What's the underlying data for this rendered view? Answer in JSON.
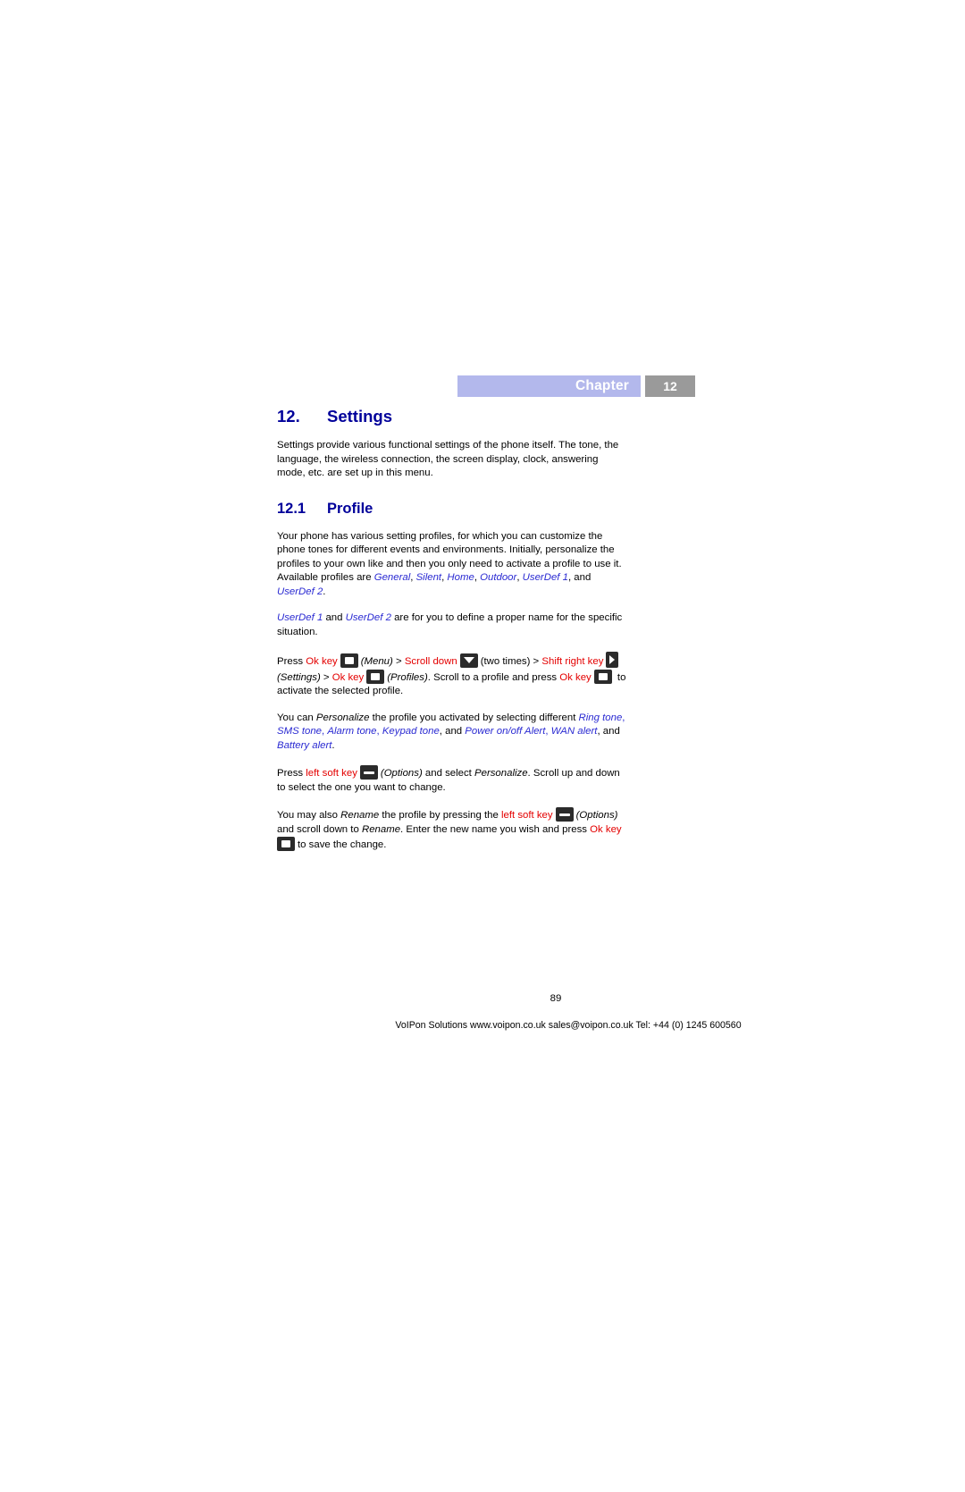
{
  "header": {
    "chapter_label": "Chapter",
    "chapter_number": "12",
    "bar_color": "#b3b8ec",
    "number_box_color": "#9a9a9a"
  },
  "heading": {
    "section_number": "12.",
    "section_title": "Settings",
    "subsection_number": "12.1",
    "subsection_title": "Profile",
    "heading_color": "#00009a"
  },
  "body": {
    "intro": "Settings provide various functional settings of the phone itself. The tone, the language, the wireless connection, the screen display, clock, answering mode, etc. are set up in this menu.",
    "profile_para_1_a": "Your phone has various setting profiles, for which you can customize the phone tones for different events and environments. Initially, personalize the profiles to your own like and then you only need to activate a profile to use it. Available profiles are ",
    "profile_list_1": "General",
    "profile_list_2": "Silent",
    "profile_list_3": "Home",
    "profile_list_4": "Outdoor",
    "profile_list_5": "UserDef 1",
    "profile_para_1_b": ", and ",
    "profile_list_6": "UserDef 2",
    "profile_para_1_c": ".",
    "profile_para_2_a": "UserDef 1",
    "profile_para_2_b": " and ",
    "profile_para_2_c": "UserDef 2",
    "profile_para_2_d": " are for you to define a proper name for the specific situation.",
    "press_1_press": "Press ",
    "press_1_ok": "Ok key",
    "press_1_menu": "(Menu)",
    "press_1_gt1": " > ",
    "press_1_scroll": "Scroll down",
    "press_1_twice": "(two times) > ",
    "press_1_shift": "Shift right key",
    "press_1_settings": "(Settings)",
    "press_1_gt2": " > ",
    "press_1_okkey2": "Ok key",
    "press_1_profiles": "(Profiles)",
    "press_1_tail": ". Scroll to a profile and press ",
    "press_1_ok3": "Ok key",
    "press_1_tail2": "to activate the selected profile.",
    "personalize_a": "You can ",
    "personalize_b": "Personalize",
    "personalize_c": " the profile you activated by selecting different ",
    "personalize_list_1": "Ring tone",
    "personalize_list_2": "SMS tone",
    "personalize_list_3": "Alarm tone",
    "personalize_list_4": "Keypad tone",
    "personalize_and": ", and ",
    "personalize_list_5": "Power on/off Alert",
    "personalize_list_6": "WAN alert",
    "personalize_and2": ", and ",
    "personalize_list_7": "Battery alert",
    "personalize_end": ".",
    "press_2_press": "Press ",
    "press_2_soft": "left soft key",
    "press_2_options": "(Options)",
    "press_2_mid": " and select ",
    "press_2_personalize": "Personalize",
    "press_2_tail": ". Scroll up and down to select the one you want to change.",
    "rename_a": "You may also ",
    "rename_b": "Rename",
    "rename_c": " the profile by pressing the ",
    "rename_soft": "left soft key",
    "rename_options": "(Options)",
    "rename_d": "and scroll down to ",
    "rename_e": "Rename",
    "rename_f": ". Enter the new name you wish and press ",
    "rename_ok": "Ok key",
    "rename_tail": "to save the change."
  },
  "footer": {
    "page_number": "89",
    "credit": "VoIPon Solutions  www.voipon.co.uk  sales@voipon.co.uk  Tel: +44 (0) 1245 600560"
  },
  "icons": {
    "ok_key": "ok-key-icon",
    "scroll_down": "scroll-down-key-icon",
    "shift_right": "shift-right-key-icon",
    "left_soft": "left-soft-key-icon"
  }
}
